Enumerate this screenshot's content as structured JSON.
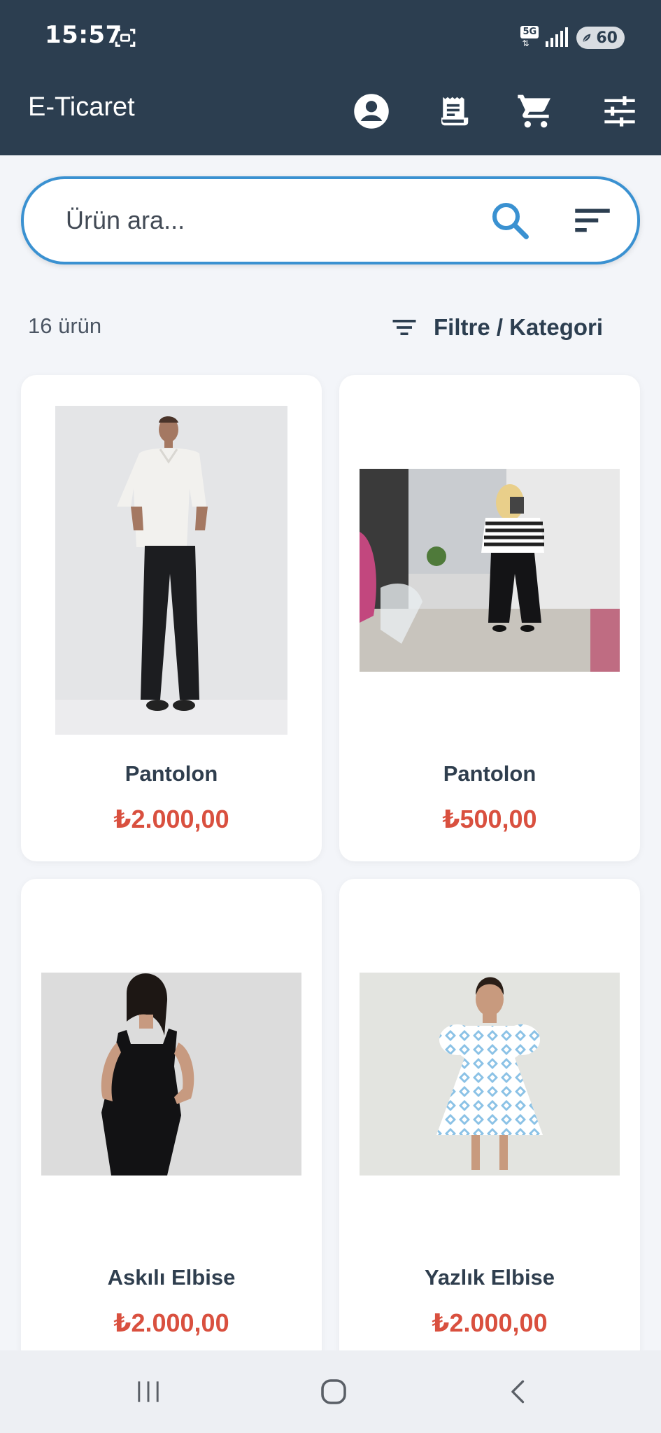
{
  "status_bar": {
    "time": "15:57",
    "network_label": "5G",
    "battery_level": "60"
  },
  "app_bar": {
    "title": "E-Ticaret",
    "icons": [
      "account-icon",
      "receipt-icon",
      "cart-icon",
      "tune-icon"
    ]
  },
  "search": {
    "placeholder": "Ürün ara...",
    "value": ""
  },
  "info": {
    "count_text": "16 ürün",
    "filter_label": "Filtre / Kategori"
  },
  "products": [
    {
      "name": "Pantolon",
      "price": "₺2.000,00"
    },
    {
      "name": "Pantolon",
      "price": "₺500,00"
    },
    {
      "name": "Askılı Elbise",
      "price": "₺2.000,00"
    },
    {
      "name": "Yazlık Elbise",
      "price": "₺2.000,00"
    }
  ],
  "colors": {
    "appbar": "#2c3e50",
    "accent": "#3a91d1",
    "price": "#d9503f",
    "background": "#f3f5f9"
  }
}
